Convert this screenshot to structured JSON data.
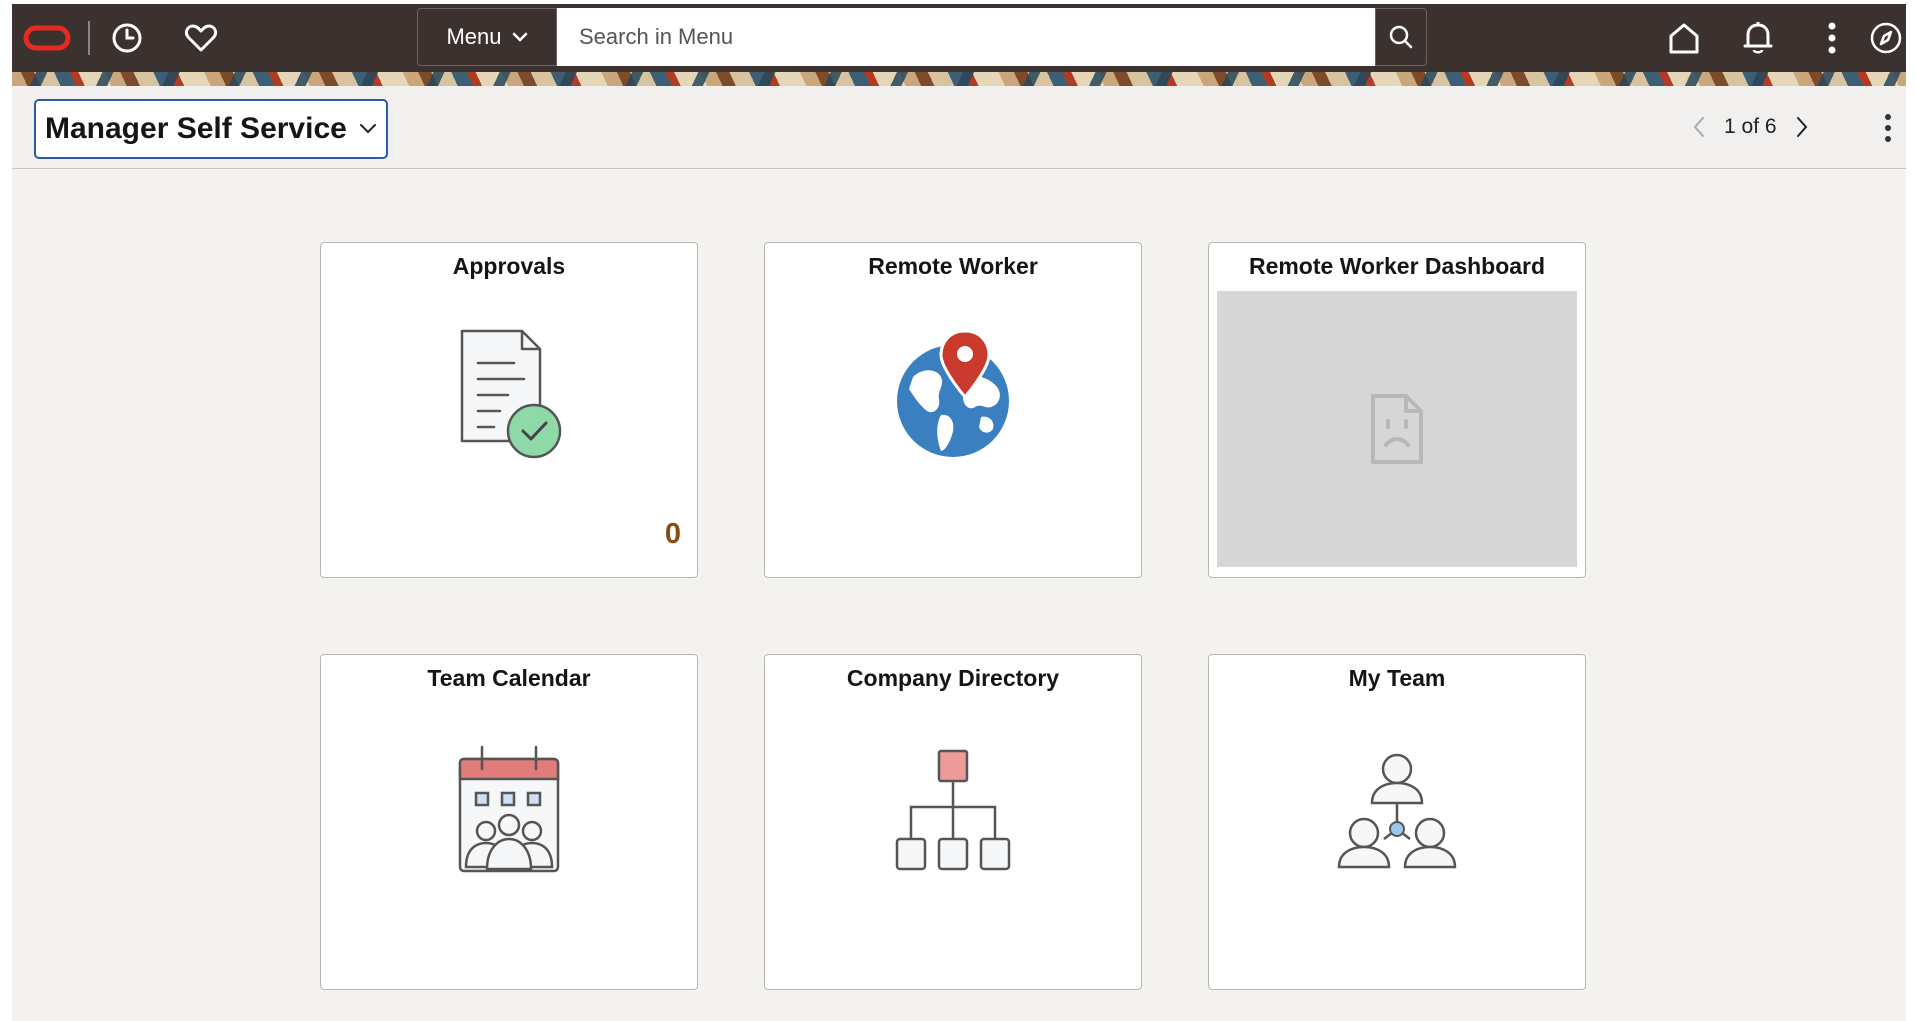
{
  "header": {
    "menu_label": "Menu",
    "search_placeholder": "Search in Menu",
    "icons": [
      "oracle-logo",
      "recent-history-icon",
      "favorites-heart-icon",
      "search-icon",
      "home-icon",
      "notifications-bell-icon",
      "actions-kebab-icon",
      "navigator-compass-icon"
    ]
  },
  "subheader": {
    "page_title": "Manager Self Service",
    "pager_text": "1 of 6"
  },
  "tiles": [
    {
      "title": "Approvals",
      "icon": "approval-document-icon",
      "count": "0"
    },
    {
      "title": "Remote Worker",
      "icon": "globe-location-icon"
    },
    {
      "title": "Remote Worker Dashboard",
      "icon": "broken-image-icon"
    },
    {
      "title": "Team Calendar",
      "icon": "team-calendar-icon"
    },
    {
      "title": "Company Directory",
      "icon": "org-chart-icon"
    },
    {
      "title": "My Team",
      "icon": "team-people-icon"
    }
  ],
  "colors": {
    "banner": "#3b3230",
    "oracle_red": "#e32b22",
    "focus_blue": "#2b5aa8",
    "count_brown": "#8a4a12",
    "calendar_red": "#e07d7b",
    "org_box_red": "#ee9a98",
    "check_green": "#8ed9a8",
    "globe_blue": "#3a7fc0",
    "pin_red": "#c9392c"
  }
}
